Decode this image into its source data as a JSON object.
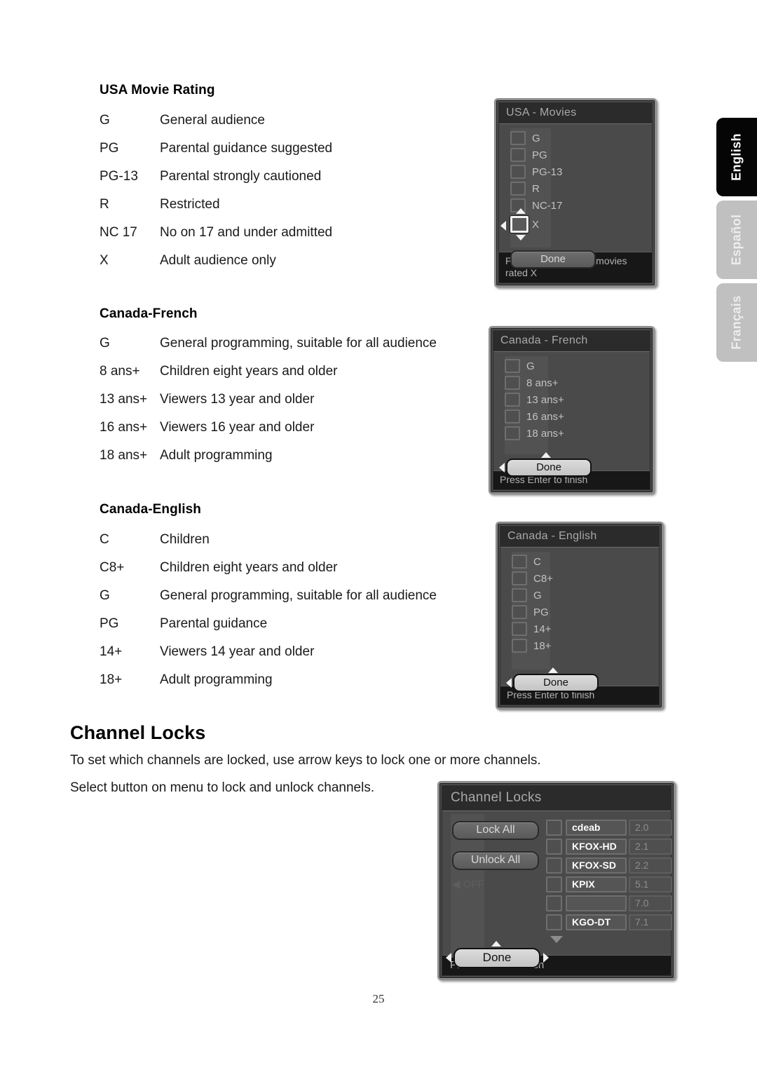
{
  "page": {
    "number": "25"
  },
  "language_tabs": [
    {
      "label": "English",
      "state": "active"
    },
    {
      "label": "Español",
      "state": "inactive"
    },
    {
      "label": "Français",
      "state": "inactive"
    }
  ],
  "sections": {
    "usa_movie": {
      "heading": "USA Movie Rating",
      "rows": [
        {
          "code": "G",
          "desc": "General audience"
        },
        {
          "code": "PG",
          "desc": "Parental guidance suggested"
        },
        {
          "code": "PG-13",
          "desc": "Parental strongly cautioned"
        },
        {
          "code": "R",
          "desc": "Restricted"
        },
        {
          "code": "NC 17",
          "desc": "No on 17 and under admitted"
        },
        {
          "code": "X",
          "desc": "Adult audience only"
        }
      ]
    },
    "canada_french": {
      "heading": "Canada-French",
      "rows": [
        {
          "code": "G",
          "desc": "General programming, suitable for all audience"
        },
        {
          "code": "8 ans+",
          "desc": "Children eight years and older"
        },
        {
          "code": "13 ans+",
          "desc": "Viewers 13 year and older"
        },
        {
          "code": "16 ans+",
          "desc": "Viewers 16 year and older"
        },
        {
          "code": "18 ans+",
          "desc": "Adult programming"
        }
      ]
    },
    "canada_english": {
      "heading": "Canada-English",
      "rows": [
        {
          "code": "C",
          "desc": "Children"
        },
        {
          "code": "C8+",
          "desc": "Children eight years and older"
        },
        {
          "code": "G",
          "desc": "General programming, suitable for all audience"
        },
        {
          "code": "PG",
          "desc": "Parental guidance"
        },
        {
          "code": "14+",
          "desc": "Viewers 14 year and older"
        },
        {
          "code": "18+",
          "desc": "Adult programming"
        }
      ]
    },
    "channel_locks": {
      "heading": "Channel Locks",
      "paragraph_1": "To set which channels are locked, use arrow keys to lock one or more channels.",
      "paragraph_2": "Select button on menu to lock and unlock channels."
    }
  },
  "osd": {
    "usa_movies": {
      "title": "USA - Movies",
      "items": [
        {
          "label": "G",
          "checked": false,
          "focused": false
        },
        {
          "label": "PG",
          "checked": false,
          "focused": false
        },
        {
          "label": "PG-13",
          "checked": false,
          "focused": false
        },
        {
          "label": "R",
          "checked": false,
          "focused": false
        },
        {
          "label": "NC-17",
          "checked": false,
          "focused": false
        },
        {
          "label": "X",
          "checked": false,
          "focused": true
        }
      ],
      "done_label": "Done",
      "footer": "Press Enter to block movies rated X"
    },
    "canada_french": {
      "title": "Canada - French",
      "items": [
        {
          "label": "G",
          "checked": false
        },
        {
          "label": "8 ans+",
          "checked": false
        },
        {
          "label": "13 ans+",
          "checked": false
        },
        {
          "label": "16 ans+",
          "checked": false
        },
        {
          "label": "18 ans+",
          "checked": false
        }
      ],
      "done_label": "Done",
      "footer": "Press Enter to finish"
    },
    "canada_english": {
      "title": "Canada - English",
      "items": [
        {
          "label": "C",
          "checked": false
        },
        {
          "label": "C8+",
          "checked": false
        },
        {
          "label": "G",
          "checked": false
        },
        {
          "label": "PG",
          "checked": false
        },
        {
          "label": "14+",
          "checked": false
        },
        {
          "label": "18+",
          "checked": false
        }
      ],
      "done_label": "Done",
      "footer": "Press Enter to finish"
    },
    "channel_locks": {
      "title": "Channel Locks",
      "lock_all_label": "Lock All",
      "unlock_all_label": "Unlock All",
      "off_label": "OFF",
      "done_label": "Done",
      "footer": "Press Enter to finish",
      "channels": [
        {
          "name": "cdeab",
          "number": "2.0",
          "locked": false
        },
        {
          "name": "KFOX-HD",
          "number": "2.1",
          "locked": false
        },
        {
          "name": "KFOX-SD",
          "number": "2.2",
          "locked": false
        },
        {
          "name": "KPIX",
          "number": "5.1",
          "locked": false
        },
        {
          "name": "",
          "number": "7.0",
          "locked": false
        },
        {
          "name": "KGO-DT",
          "number": "7.1",
          "locked": false
        }
      ]
    }
  },
  "colors": {
    "osd_body": "#4a4a4a",
    "osd_title_bar": "#2b2b2b",
    "osd_footer": "#171717",
    "osd_border": "#8d8d8d",
    "tab_active": "#050505",
    "tab_inactive": "#c0c0c0",
    "text": "#1a1a1a"
  }
}
